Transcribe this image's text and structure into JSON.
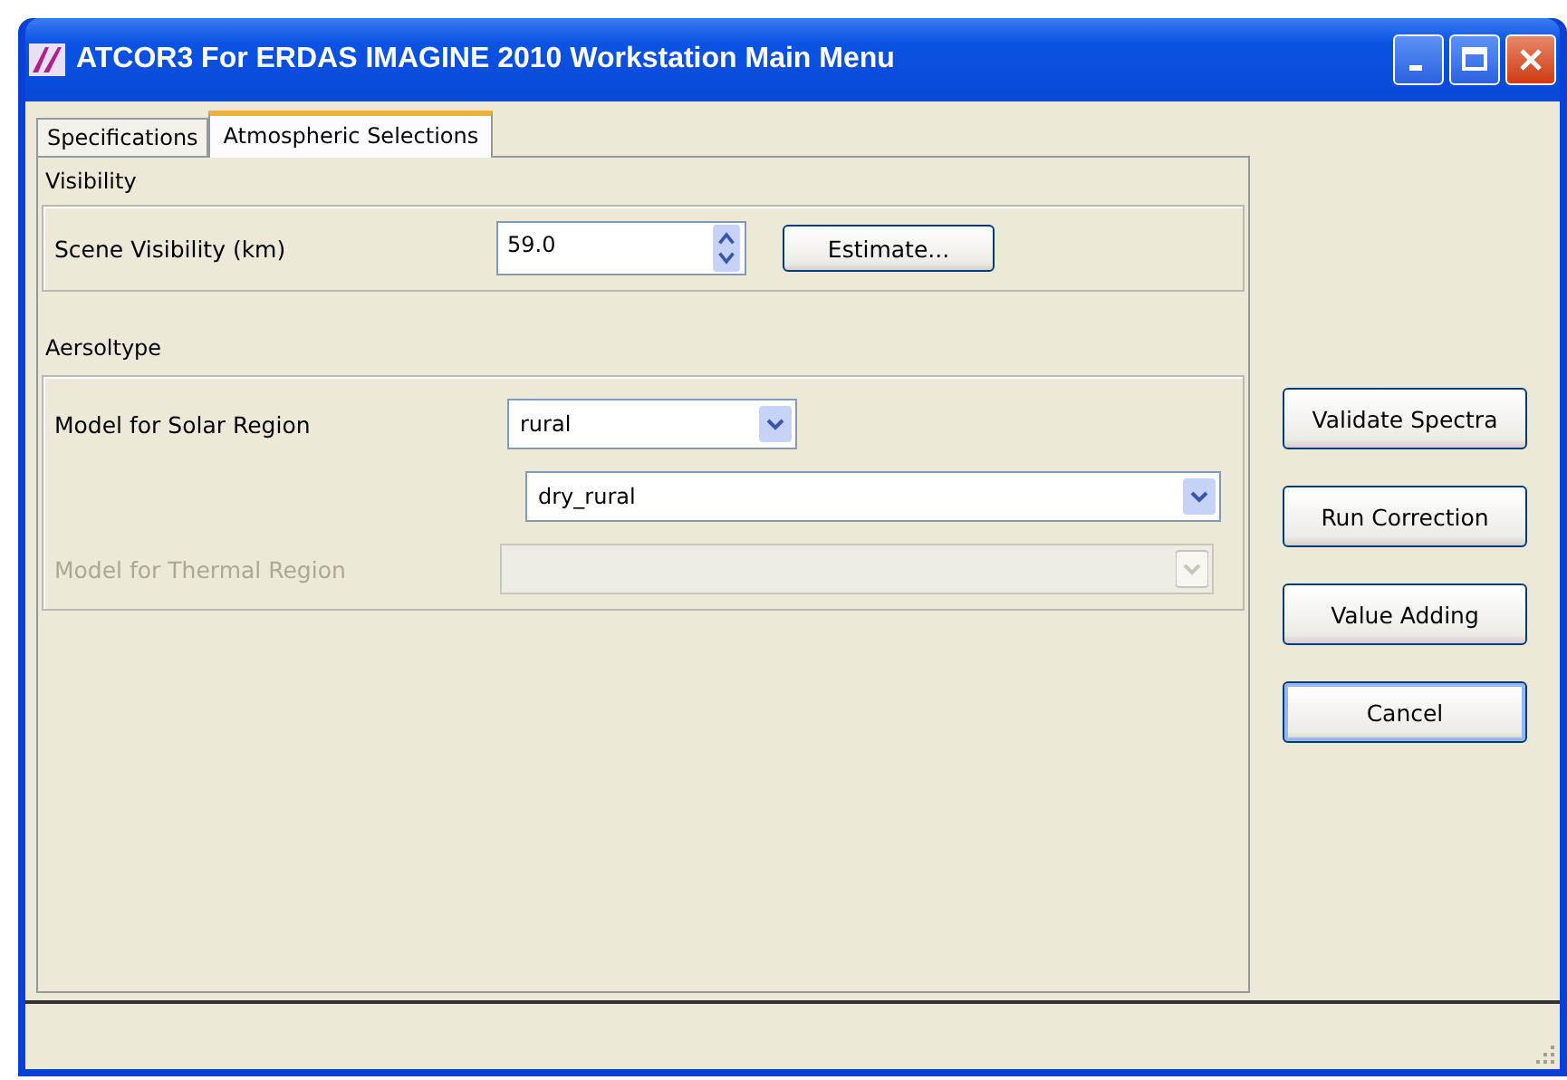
{
  "window": {
    "title": "ATCOR3 For ERDAS IMAGINE 2010  Workstation Main Menu"
  },
  "tabs": [
    {
      "label": "Specifications",
      "selected": false
    },
    {
      "label": "Atmospheric Selections",
      "selected": true
    }
  ],
  "visibility": {
    "heading": "Visibility",
    "label": "Scene Visibility (km)",
    "value": "59.0",
    "button": "Estimate..."
  },
  "aerosol": {
    "heading": "Aersoltype",
    "solar_label": "Model for Solar Region",
    "solar_value": "rural",
    "sub_value": "dry_rural",
    "thermal_label": "Model for Thermal Region",
    "thermal_disabled": true
  },
  "buttons": [
    {
      "label": "Validate Spectra",
      "default": false
    },
    {
      "label": "Run Correction",
      "default": false
    },
    {
      "label": "Value Adding",
      "default": false
    },
    {
      "label": "Cancel",
      "default": true
    }
  ]
}
